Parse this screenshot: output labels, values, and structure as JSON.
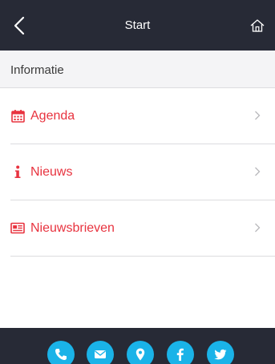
{
  "header": {
    "title": "Start",
    "back_icon": "chevron-left-icon",
    "home_icon": "home-icon"
  },
  "section": {
    "title": "Informatie"
  },
  "menu": {
    "items": [
      {
        "label": "Agenda",
        "icon": "calendar-icon"
      },
      {
        "label": "Nieuws",
        "icon": "info-icon"
      },
      {
        "label": "Nieuwsbrieven",
        "icon": "newspaper-icon"
      }
    ]
  },
  "footer": {
    "icons": [
      "phone-icon",
      "mail-icon",
      "location-pin-icon",
      "facebook-icon",
      "twitter-icon"
    ]
  },
  "colors": {
    "bar_background": "#272a36",
    "accent_red": "#e8333f",
    "social_blue": "#1ab3e8",
    "section_background": "#f4f4f6"
  }
}
